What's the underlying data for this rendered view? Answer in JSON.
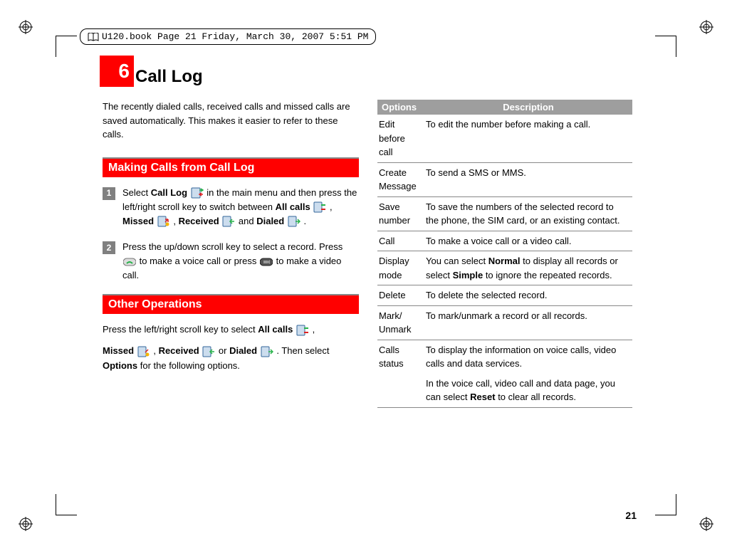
{
  "header_path": "U120.book  Page 21  Friday, March 30, 2007  5:51 PM",
  "chapter": {
    "num": "6",
    "title": "Call Log"
  },
  "intro": "The recently dialed calls, received calls and missed calls are saved automatically. This makes it easier to refer to these calls.",
  "section1": {
    "title": "Making Calls from Call Log"
  },
  "steps": {
    "s1a": "Select ",
    "s1b": "Call Log",
    "s1c": " in the main menu and then press the left/right scroll key to switch between ",
    "s1d": "All calls",
    "s1e": " , ",
    "s1f": "Missed",
    "s1g": ", ",
    "s1h": "Received",
    "s1i": " and ",
    "s1j": "Dialed",
    "s1k": ".",
    "s2a": "Press the up/down scroll key to select a record. Press ",
    "s2b": " to make a voice call or press ",
    "s2c": " to make a video call."
  },
  "section2": {
    "title": "Other Operations"
  },
  "other": {
    "p1a": "Press the left/right scroll key to select ",
    "p1b": "All calls",
    "p1c": " , ",
    "p1d": "Missed",
    "p1e": " , ",
    "p1f": "Received ",
    "p1g": "or ",
    "p1h": "Dialed",
    "p1i": " . Then select ",
    "p1j": "Options",
    "p1k": " for the following options."
  },
  "table": {
    "h1": "Options",
    "h2": "Description",
    "rows": [
      {
        "opt": "Edit before call",
        "desc": "To edit the number before making a call."
      },
      {
        "opt": "Create Message",
        "desc": "To send a SMS or MMS."
      },
      {
        "opt": "Save number",
        "desc": "To save the numbers of the selected record to the phone, the SIM card, or an existing contact."
      },
      {
        "opt": "Call",
        "desc": "To make a voice call or a video call."
      },
      {
        "opt": "Display mode",
        "desc_a": "You can select ",
        "desc_b": "Normal",
        "desc_c": " to display all records or select ",
        "desc_d": "Simple",
        "desc_e": " to ignore the repeated records."
      },
      {
        "opt": "Delete",
        "desc": "To delete the selected record."
      },
      {
        "opt": "Mark/ Unmark",
        "desc": "To mark/unmark a record or all records."
      },
      {
        "opt": "Calls status",
        "desc_a": "To display the information on voice calls, video calls and data services.",
        "desc_b": "In the voice call, video call and data page, you can select ",
        "desc_c": "Reset",
        "desc_d": " to clear all records."
      }
    ]
  },
  "page_num": "21"
}
